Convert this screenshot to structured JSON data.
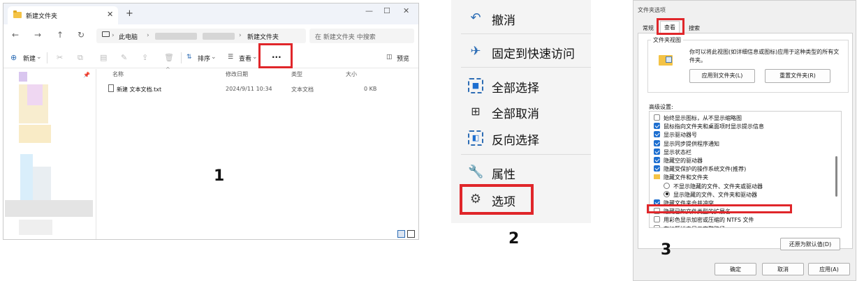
{
  "explorer": {
    "tab_title": "新建文件夹",
    "tab_close": "✕",
    "new_tab": "+",
    "window_buttons": [
      "—",
      "☐",
      "✕"
    ],
    "nav": [
      "←",
      "→",
      "↑",
      "↻"
    ],
    "breadcrumb": {
      "pc": "此电脑",
      "sep": "›",
      "folder": "新建文件夹"
    },
    "search_placeholder": "在 新建文件夹 中搜索",
    "toolbar": {
      "new_label": "新建",
      "sort_label": "排序",
      "view_label": "查看",
      "more_label": "···",
      "preview_label": "预览",
      "chevron": "⌄"
    },
    "columns": [
      "名称",
      "修改日期",
      "类型",
      "大小"
    ],
    "files": [
      {
        "name": "新建 文本文档.txt",
        "date": "2024/9/11 10:34",
        "type": "文本文档",
        "size": "0 KB"
      }
    ],
    "step_label": "1"
  },
  "menu": {
    "items": [
      {
        "label": "撤消",
        "icon": "undo-icon"
      },
      {
        "label": "固定到快速访问",
        "icon": "pin-icon"
      },
      {
        "label": "全部选择",
        "icon": "select-all-icon"
      },
      {
        "label": "全部取消",
        "icon": "select-none-icon"
      },
      {
        "label": "反向选择",
        "icon": "invert-selection-icon"
      },
      {
        "label": "属性",
        "icon": "wrench-icon"
      },
      {
        "label": "选项",
        "icon": "gear-icon"
      }
    ],
    "step_label": "2"
  },
  "dialog": {
    "title": "文件夹选项",
    "tabs": [
      "常规",
      "查看",
      "搜索"
    ],
    "group_legend": "文件夹视图",
    "group_desc": "你可以将此视图(如详细信息或图标)应用于这种类型的所有文件夹。",
    "apply_button": "应用到文件夹(L)",
    "reset_button": "重置文件夹(R)",
    "advanced_label": "高级设置:",
    "advanced": [
      {
        "kind": "check",
        "checked": false,
        "text": "始终显示图标，从不显示缩略图"
      },
      {
        "kind": "check",
        "checked": true,
        "text": "鼠标指向文件夹和桌面项时显示提示信息"
      },
      {
        "kind": "check",
        "checked": true,
        "text": "显示驱动器号"
      },
      {
        "kind": "check",
        "checked": true,
        "text": "显示同步提供程序通知"
      },
      {
        "kind": "check",
        "checked": true,
        "text": "显示状态栏"
      },
      {
        "kind": "check",
        "checked": true,
        "text": "隐藏空的驱动器"
      },
      {
        "kind": "check",
        "checked": true,
        "text": "隐藏受保护的操作系统文件(推荐)"
      },
      {
        "kind": "folder",
        "checked": false,
        "text": "隐藏文件和文件夹"
      },
      {
        "kind": "radio",
        "checked": false,
        "text": "不显示隐藏的文件、文件夹或驱动器"
      },
      {
        "kind": "radio",
        "checked": true,
        "text": "显示隐藏的文件、文件夹和驱动器"
      },
      {
        "kind": "check",
        "checked": true,
        "text": "隐藏文件夹合并冲突"
      },
      {
        "kind": "check",
        "checked": false,
        "text": "隐藏已知文件类型的扩展名"
      },
      {
        "kind": "check",
        "checked": false,
        "text": "用彩色显示加密或压缩的 NTFS 文件"
      },
      {
        "kind": "check",
        "checked": false,
        "text": "在标题栏中显示完整路径"
      }
    ],
    "restore_button": "还原为默认值(D)",
    "ok_button": "确定",
    "cancel_button": "取消",
    "apply_main_button": "应用(A)",
    "step_label": "3"
  },
  "colors": {
    "highlight": "#e0262a",
    "accent": "#1e6fd0",
    "menu_icon": "#2d6db5"
  }
}
